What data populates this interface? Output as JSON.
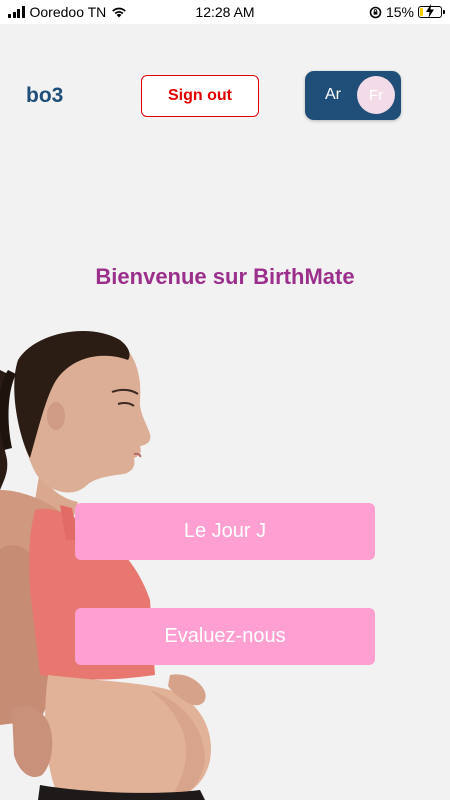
{
  "status_bar": {
    "carrier": "Ooredoo TN",
    "time": "12:28 AM",
    "battery": "15%",
    "battery_level": 0.15
  },
  "header": {
    "app_name": "bo3",
    "signout_label": "Sign out",
    "lang_ar": "Ar",
    "lang_fr": "Fr",
    "selected_language": "Fr"
  },
  "main": {
    "welcome": "Bienvenue sur BirthMate",
    "buttons": [
      {
        "label": "Le Jour J"
      },
      {
        "label": "Evaluez-nous"
      }
    ]
  },
  "colors": {
    "brand_blue": "#1f4e79",
    "signout_red": "#e00000",
    "welcome_purple": "#9b2f8c",
    "button_pink": "#ff9fd2"
  }
}
